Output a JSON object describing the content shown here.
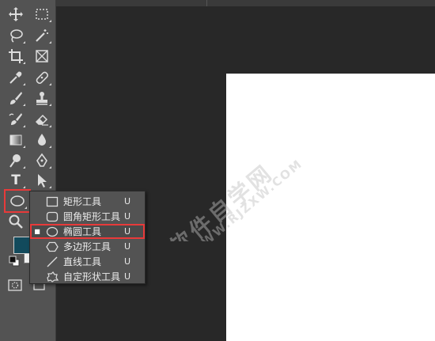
{
  "flyout": {
    "items": [
      {
        "label": "矩形工具",
        "shortcut": "U",
        "icon": "rectangle-icon",
        "selected": false
      },
      {
        "label": "圆角矩形工具",
        "shortcut": "U",
        "icon": "rounded-rectangle-icon",
        "selected": false
      },
      {
        "label": "椭圆工具",
        "shortcut": "U",
        "icon": "ellipse-icon",
        "selected": true,
        "marker": "■"
      },
      {
        "label": "多边形工具",
        "shortcut": "U",
        "icon": "polygon-icon",
        "selected": false
      },
      {
        "label": "直线工具",
        "shortcut": "U",
        "icon": "line-icon",
        "selected": false
      },
      {
        "label": "自定形状工具",
        "shortcut": "U",
        "icon": "custom-shape-icon",
        "selected": false
      }
    ]
  },
  "colors": {
    "foreground": "#124a5c",
    "background": "#f0f0f0",
    "highlight": "#e83a3a"
  },
  "watermark": {
    "line1": "软件自学网",
    "line2": "WWW.RJZXW.COM"
  },
  "toolbar": {
    "type_tool_glyph": "T"
  }
}
